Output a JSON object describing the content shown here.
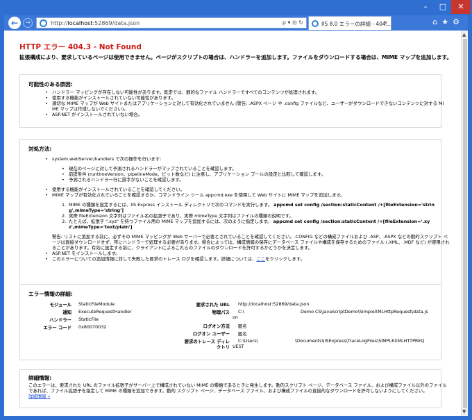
{
  "browser": {
    "url_prefix": "http://",
    "url_host": "localhost",
    "url_rest": ":52869/data.json",
    "address_tools": "ρ ▾ ⊡ ↻",
    "tab_title": "IIS 8.0 エラーの詳細 - 404....",
    "tab_close": "×",
    "window_buttons": {
      "minimize": "–",
      "maximize": "□",
      "close": "✕"
    },
    "right_tools": "⌂★⚙"
  },
  "page": {
    "title": "HTTP エラー 404.3 - Not Found",
    "subtitle": "拡張構成により、要求しているページは使用できません。ページがスクリプトの場合は、ハンドラーを追加します。ファイルをダウンロードする場合は、MIME マップを追加します。"
  },
  "causes": {
    "heading": "可能性のある原因:",
    "items": [
      "ハンドラー マッピングが存在しない可能性があります。既定では、静的なファイル ハンドラーですべてのコンテンツが処理されます。",
      "使用する機能がインストールされていない可能性があります。",
      "適切な MIME マップが Web サイトまたはアプリケーションに対して有効化されていません (警告: .ASPX ページ や .config ファイルなど、ユーザーがダウンロードできないコンテンツに対する MI",
      "ME マップは作成しないでください)。",
      "ASP.NET がインストールされていない場合。"
    ]
  },
  "actions": {
    "heading": "対処方法:",
    "item1": "system.webServer/handlers で次の操作を行います:",
    "sub": [
      "現在のページに対して予測されるハンドラーがマップされていることを確認します。",
      "前提条件 (runtimeVersion、pipelineMode、ビット数など) に注意し、アプリケーション プールの設定と比較して確認します。",
      "予測されるハンドラー行に誤字がないことを確認します。"
    ],
    "item2": "使用する機能がインストールされていることを確認してください。",
    "item3": "MIME マップが有効化されていることを確認するか、コマンドライン ツール appcmd.exe を使用して Web サイトに MIME マップを追加します。",
    "step1_a": "MIME の種類を設定するには、IIS Express インストール ディレクトリで次のコマンドを実行します。",
    "step1_b": "appcmd set config /section:staticContent /+[fileExtension='strin",
    "step1_c": "g',mimeType='string']",
    "step2": "実際 fileExtension 文字列はファイル名の拡張子であり、実際 mimeType 文字列はファイルの種類の説明です。",
    "step3_a": "たとえば、拡張子 \".xyz\" を持つファイル用の MIME マップを追加するには、次のように指定します。",
    "step3_b": "appcmd set config /section:staticContent /+[fileExtension='.xy",
    "step3_c": "z',mimeType='text/plain']",
    "warning": [
      "警告: リストに追加する前に、必ずその MIME マッピングが Web サーバーで必要とされていることを確認してください。.CONFIG などの構成ファイルおよび .ASP、.ASPX などの動的スクリプト ペ",
      "ージは直接ダウンロードせず、常にハンドラーで処理する必要があります。場合によっては、構成情報の保存にデータベース ファイルや構成を保存するためのファイル (.XML、.MDF など) が使用され",
      "ることがあります。有効に設定する前に、クライアントによるこれらのファイルのダウンロードを許可するかどうかを決定します。"
    ],
    "item4": "ASP.NET をインストールします。",
    "item5_pre": "このエラーについての追加情報に対して失敗した要求のトレース ログを確認します。詳細については、",
    "item5_link": "ここ",
    "item5_post": "をクリックします。"
  },
  "details": {
    "heading": "エラー情報の詳細:",
    "left": [
      {
        "label": "モジュール",
        "value": "StaticFileModule"
      },
      {
        "label": "通知",
        "value": "ExecuteRequestHandler"
      },
      {
        "label": "ハンドラー",
        "value": "StaticFile"
      },
      {
        "label": "エラー コード",
        "value": "0x80070032"
      }
    ],
    "url_label": "要求された URL",
    "url_value": "http://localhost:52869/data.json",
    "path_label": "物理パス",
    "path_value_1": "C:\\",
    "path_value_2": "Demo CS\\JavaScriptDemo\\SimpleXMLHttpRequest\\data.js",
    "path_value_3": "on",
    "logon_label": "ログオン方法",
    "logon_value": "匿名",
    "logonuser_label": "ログオン ユーザー",
    "logonuser_value": "匿名",
    "trace_label_1": "要求のトレース ディレ",
    "trace_label_2": "クトリ",
    "trace_value_1": "C:\\Users\\",
    "trace_value_2": "\\Documents\\IISExpress\\TraceLogFiles\\SIMPLEXMLHTTPREQ",
    "trace_value_3": "UEST"
  },
  "more": {
    "heading": "詳細情報:",
    "text1": "このエラーは、要求された URL のファイル拡張子がサーバー上で構成されていない MIME の種類であるときに発生します。動的スクリプト ページ、データベース ファイル、および構成ファイル以外のファイル",
    "text2": "であれば、ファイル拡張子を指定して MIME の種類を追加できます。動的 スクリプト ページ、データベース ファイル、および構成ファイルの直接的なダウンロードを許可しないようにしてください。",
    "link": "詳細情報 »"
  }
}
